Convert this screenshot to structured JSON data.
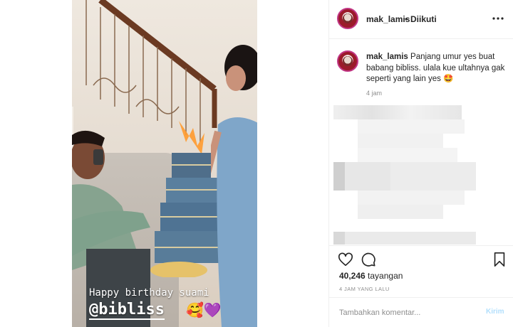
{
  "post": {
    "username": "mak_lamis",
    "separator": "•",
    "follow_status": "Diikuti"
  },
  "caption": {
    "username": "mak_lamis",
    "text": "Panjang umur yes buat babang bibliss. ulala kue ultahnya gak seperti yang lain yes 🤩",
    "time": "4 jam"
  },
  "story": {
    "line1": "Happy birthday suami",
    "line2": "@bibliss",
    "emoji": "🥰💜"
  },
  "actions": {
    "views_count": "40,246",
    "views_label": "tayangan",
    "time_ago": "4 JAM YANG LALU",
    "comment_placeholder": "Tambahkan komentar...",
    "post_label": "Kirim"
  },
  "icons": {
    "more": "more-options-icon",
    "like": "heart-icon",
    "comment": "comment-bubble-icon",
    "save": "bookmark-icon"
  },
  "colors": {
    "text": "#262626",
    "muted": "#8e8e8e",
    "post_button_disabled": "#b2dffc",
    "border": "#efefef"
  }
}
